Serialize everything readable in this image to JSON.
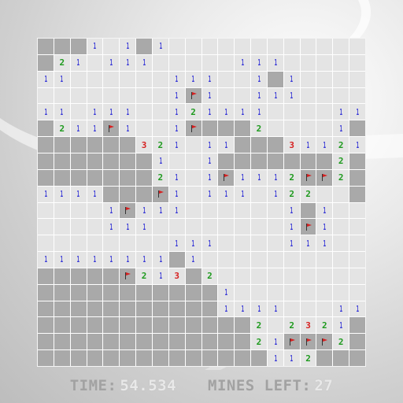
{
  "status": {
    "time_label": "TIME:",
    "time_value": "54.534",
    "mines_label": "MINES LEFT:",
    "mines_value": "27"
  },
  "colors": {
    "covered": "#a9a9a9",
    "open": "#e4e4e4",
    "grid_line": "#ffffff",
    "num1": "#3a3ad6",
    "num2": "#1e9a1e",
    "num3": "#d62020",
    "flag": "#d62020"
  },
  "board": {
    "rows": 20,
    "cols": 20,
    "legend": "# = covered, F = flagged, . = empty open, digit = open with adjacent-mine count",
    "grid": [
      "###1.1#1............",
      "#21.111.....111.....",
      "11......111..1#1....",
      "........1F1..111....",
      "11.111..121111....11",
      "#211F1..1F###2....1#",
      "######321.11###31121",
      "#######1..1#######2#",
      "#######21.1F1112FF2#",
      "1111###F1.111.122..#",
      "....1F111......1#1..",
      "....111........1F1..",
      "........111....111..",
      "11111111#1..........",
      "#####F213#2.........",
      "###########1........",
      "###########1111...11",
      "#############2.2321#",
      "#############21FFF2#",
      "##############112###"
    ]
  }
}
